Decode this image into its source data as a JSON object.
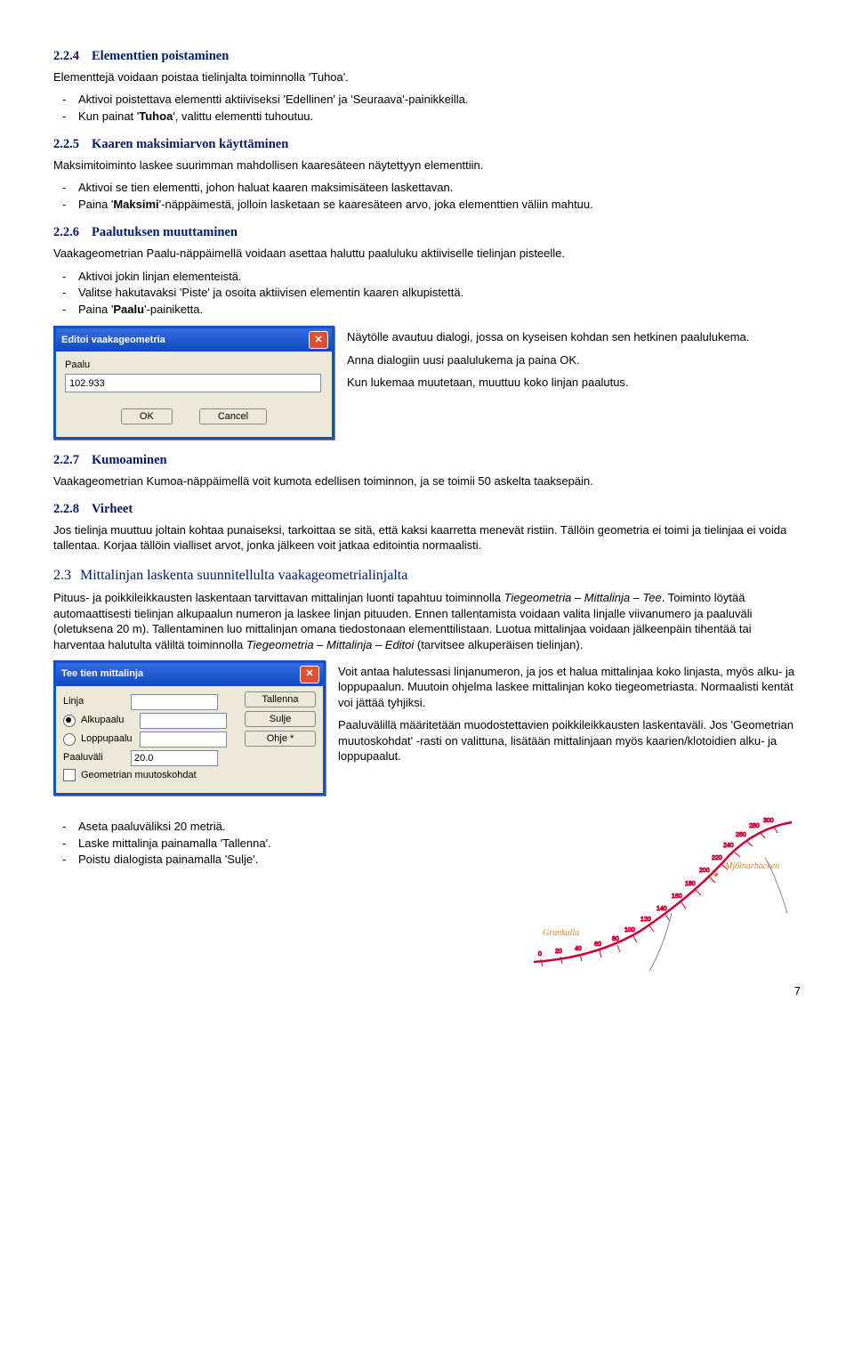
{
  "s224": {
    "num": "2.2.4",
    "title": "Elementtien poistaminen",
    "p": "Elementtejä voidaan poistaa tielinjalta toiminnolla 'Tuhoa'.",
    "li1": "Aktivoi poistettava elementti aktiiviseksi 'Edellinen' ja 'Seuraava'-painikkeilla.",
    "li2_a": "Kun painat '",
    "li2_b": "Tuhoa",
    "li2_c": "', valittu elementti tuhoutuu."
  },
  "s225": {
    "num": "2.2.5",
    "title": "Kaaren maksimiarvon käyttäminen",
    "p": "Maksimitoiminto laskee suurimman mahdollisen kaaresäteen näytettyyn elementtiin.",
    "li1": "Aktivoi se tien elementti, johon haluat kaaren maksimisäteen laskettavan.",
    "li2_a": "Paina '",
    "li2_b": "Maksimi",
    "li2_c": "'-näppäimestä, jolloin lasketaan se kaaresäteen arvo, joka elementtien väliin mahtuu."
  },
  "s226": {
    "num": "2.2.6",
    "title": "Paalutuksen muuttaminen",
    "p": "Vaakageometrian Paalu-näppäimellä voidaan asettaa haluttu paaluluku aktiiviselle tielinjan pisteelle.",
    "li1": "Aktivoi jokin linjan elementeistä.",
    "li2": "Valitse hakutavaksi 'Piste' ja osoita aktiivisen elementin kaaren alkupistettä.",
    "li3_a": "Paina '",
    "li3_b": "Paalu",
    "li3_c": "'-painiketta.",
    "dlg_title": "Editoi vaakageometria",
    "dlg_label": "Paalu",
    "dlg_value": "102.933",
    "dlg_ok": "OK",
    "dlg_cancel": "Cancel",
    "rt1": "Näytölle avautuu dialogi, jossa on kyseisen kohdan sen hetkinen paalulukema.",
    "rt2": "Anna dialogiin uusi paalulukema ja paina OK.",
    "rt3": "Kun lukemaa muutetaan, muuttuu koko linjan paalutus."
  },
  "s227": {
    "num": "2.2.7",
    "title": "Kumoaminen",
    "p": "Vaakageometrian Kumoa-näppäimellä voit kumota edellisen toiminnon, ja se toimii 50 askelta taaksepäin."
  },
  "s228": {
    "num": "2.2.8",
    "title": "Virheet",
    "p": "Jos tielinja muuttuu joltain kohtaa punaiseksi, tarkoittaa se sitä, että kaksi kaarretta menevät ristiin. Tällöin geometria ei toimi ja tielinjaa ei voida tallentaa. Korjaa tällöin vialliset arvot, jonka jälkeen voit jatkaa editointia normaalisti."
  },
  "s23": {
    "num": "2.3",
    "title": "Mittalinjan laskenta suunnitellulta vaakageometrialinjalta",
    "p1_a": "Pituus- ja poikkileikkausten laskentaan tarvittavan mittalinjan luonti tapahtuu toiminnolla ",
    "p1_i": "Tiegeometria – Mittalinja – Tee",
    "p1_b": ". Toiminto löytää automaattisesti tielinjan alkupaalun numeron ja laskee linjan pituuden. Ennen tallentamista voidaan valita linjalle viivanumero ja paaluväli (oletuksena 20 m). Tallentaminen luo mittalinjan omana tiedostonaan elementtilistaan. Luotua mittalinjaa voidaan jälkeenpäin tihentää tai harventaa halutulta väliltä toiminnolla ",
    "p1_i2": "Tiegeometria – Mittalinja – Editoi",
    "p1_c": " (tarvitsee alkuperäisen tielinjan).",
    "dlg_title": "Tee tien mittalinja",
    "lbl_linja": "Linja",
    "lbl_alku": "Alkupaalu",
    "lbl_loppu": "Loppupaalu",
    "lbl_paaluvali": "Paaluväli",
    "val_paaluvali": "20.0",
    "lbl_geom": "Geometrian muutoskohdat",
    "btn_tallenna": "Tallenna",
    "btn_sulje": "Sulje",
    "btn_ohje": "Ohje *",
    "rt1": "Voit antaa halutessasi linjanumeron, ja jos et halua mittalinjaa koko linjasta, myös alku- ja loppupaalun. Muutoin ohjelma laskee mittalinjan koko tiegeometriasta. Normaalisti kentät voi jättää tyhjiksi.",
    "rt2": "Paaluvälillä määritetään muodostettavien poikkileikkausten laskentaväli. Jos 'Geometrian muutoskohdat' -rasti on valittuna, lisätään mittalinjaan myös kaarien/klotoidien alku- ja loppupaalut."
  },
  "bottom": {
    "li1": "Aseta paaluväliksi 20 metriä.",
    "li2": "Laske mittalinja painamalla 'Tallenna'.",
    "li3": "Poistu dialogista painamalla 'Sulje'.",
    "map_label1": "Grankulla",
    "map_label2": "Mjölnarbacken"
  },
  "pagenum": "7"
}
